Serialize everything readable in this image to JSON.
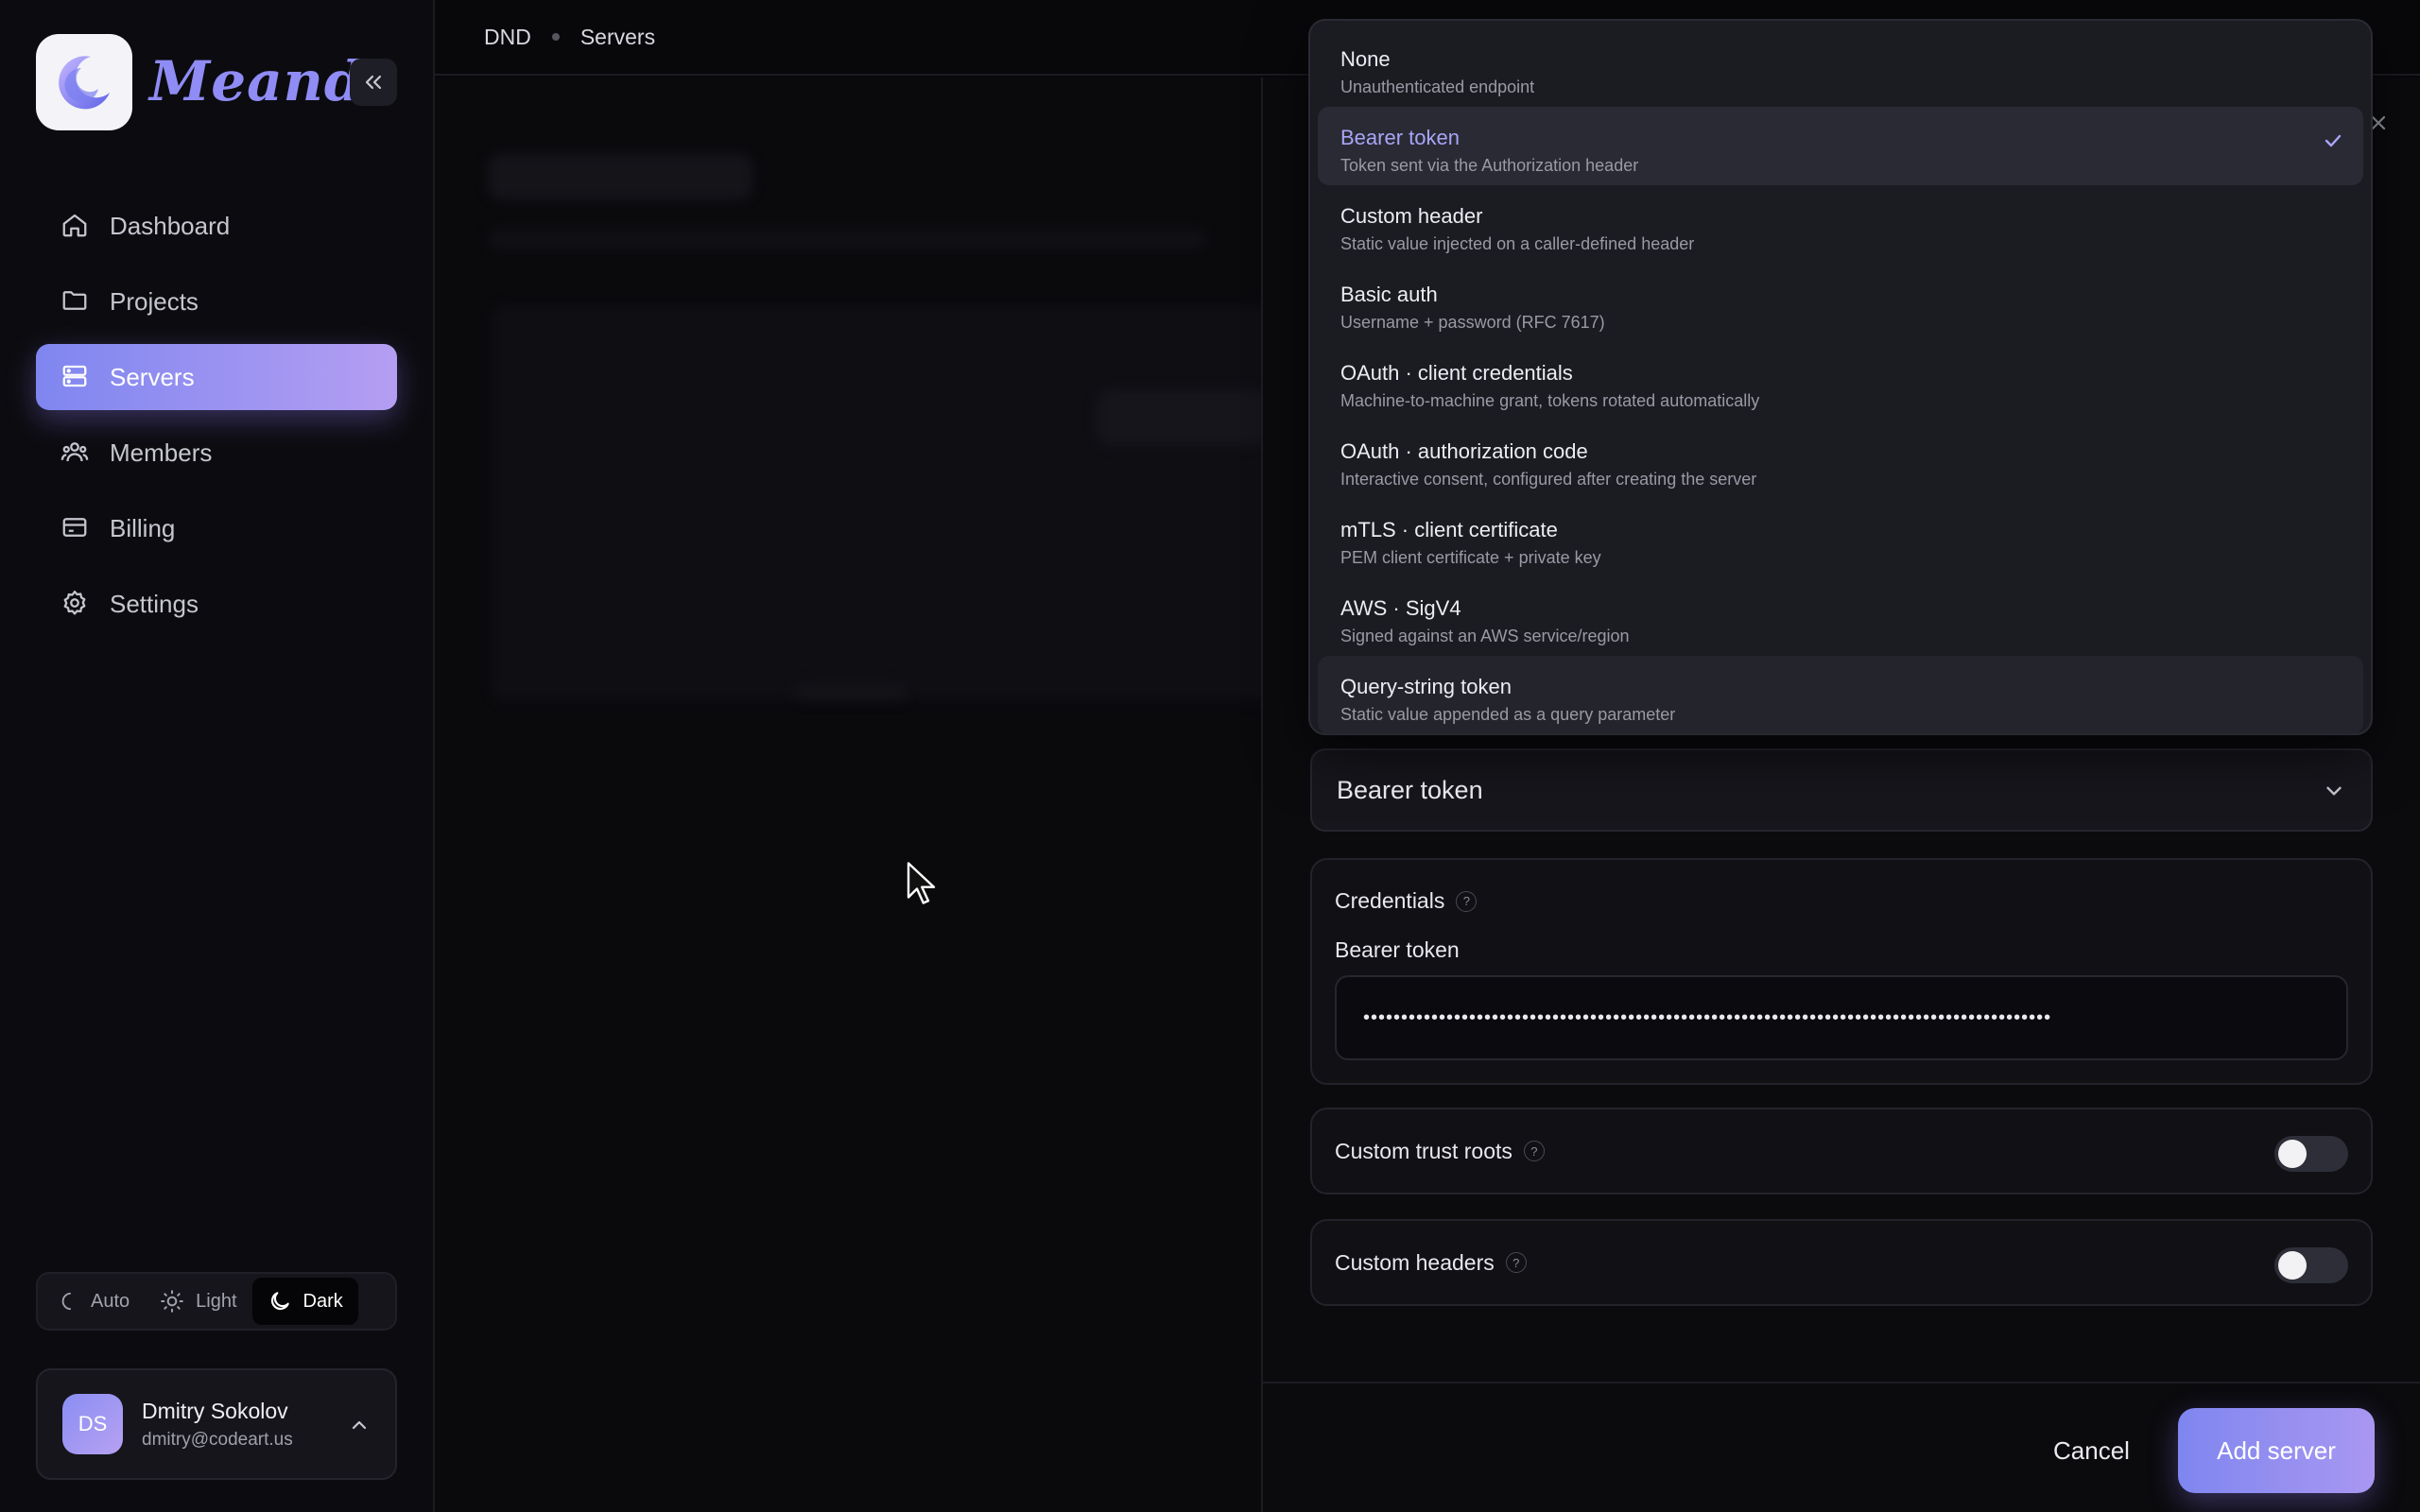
{
  "app": {
    "brand": "Meandr",
    "logo_icon": "crescent-moon-logo"
  },
  "sidebar": {
    "items": [
      {
        "label": "Dashboard",
        "icon": "home-icon"
      },
      {
        "label": "Projects",
        "icon": "folder-icon"
      },
      {
        "label": "Servers",
        "icon": "server-icon",
        "active": true
      },
      {
        "label": "Members",
        "icon": "members-icon"
      },
      {
        "label": "Billing",
        "icon": "credit-card-icon"
      },
      {
        "label": "Settings",
        "icon": "gear-icon"
      }
    ],
    "theme": {
      "auto": "Auto",
      "light": "Light",
      "dark": "Dark",
      "selected": "Dark"
    },
    "user": {
      "initials": "DS",
      "name": "Dmitry Sokolov",
      "email": "dmitry@codeart.us"
    }
  },
  "breadcrumb": {
    "org": "DND",
    "page": "Servers"
  },
  "auth_dropdown": {
    "selected": "Bearer token",
    "options": [
      {
        "title": "None",
        "desc": "Unauthenticated endpoint"
      },
      {
        "title": "Bearer token",
        "desc": "Token sent via the Authorization header"
      },
      {
        "title": "Custom header",
        "desc": "Static value injected on a caller-defined header"
      },
      {
        "title": "Basic auth",
        "desc": "Username + password (RFC 7617)"
      },
      {
        "title": "OAuth · client credentials",
        "desc": "Machine-to-machine grant, tokens rotated automatically"
      },
      {
        "title": "OAuth · authorization code",
        "desc": "Interactive consent, configured after creating the server"
      },
      {
        "title": "mTLS · client certificate",
        "desc": "PEM client certificate + private key"
      },
      {
        "title": "AWS · SigV4",
        "desc": "Signed against an AWS service/region"
      },
      {
        "title": "Query-string token",
        "desc": "Static value appended as a query parameter"
      }
    ]
  },
  "credentials": {
    "title": "Credentials",
    "help": "?",
    "bearer_label": "Bearer token",
    "bearer_value": "•••••••••••••••••••••••••••••••••••••••••••••••••••••••••••••••••••••••••••••••••••••••••••"
  },
  "toggles": {
    "trust_roots": {
      "label": "Custom trust roots",
      "enabled": false
    },
    "headers": {
      "label": "Custom headers",
      "enabled": false
    }
  },
  "footer": {
    "cancel": "Cancel",
    "add": "Add server"
  },
  "colors": {
    "accent": "#8b8ff2",
    "background": "#08080b"
  }
}
